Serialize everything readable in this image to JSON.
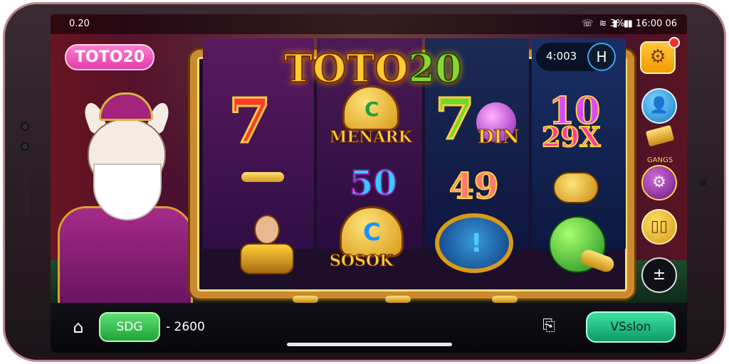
{
  "status_bar": {
    "time": "0.20",
    "icons": "☏ ≋ ▮ ▮ ",
    "battery": "3%",
    "clock_right": "16:00 06",
    "divider": "▮"
  },
  "header": {
    "logo_pill": "TOTO20",
    "title_main": "TOTO",
    "title_num": "20",
    "balance": "4:003",
    "balance_icon": "H",
    "settings_icon": "gear-icon"
  },
  "reels": {
    "reel1_top": "7",
    "reel2_top_label": "MENARK",
    "reel2_top_glyph": "C",
    "reel2_mid": "50",
    "reel2_bottom_glyph": "C",
    "reel2_bottom_label": "SOSOK",
    "reel3_top": "7",
    "reel3_top_label": "DIN",
    "reel3_mid": "49",
    "reel3_bottom_glyph": "!",
    "reel4_top": "10",
    "reel4_top2": "29X"
  },
  "side_panel": {
    "gears_label": "GANGS",
    "cards_icon": "▯▯",
    "menu_icon": "±"
  },
  "bottom_bar": {
    "bet_label": "SDG",
    "bet_amount": "- 2600",
    "spin_label": "VSslon"
  },
  "colors": {
    "accent_pink": "#e23fa8",
    "accent_gold": "#ffcc2e",
    "accent_green": "#1fa33a",
    "spin_green": "#0f9a6a"
  }
}
